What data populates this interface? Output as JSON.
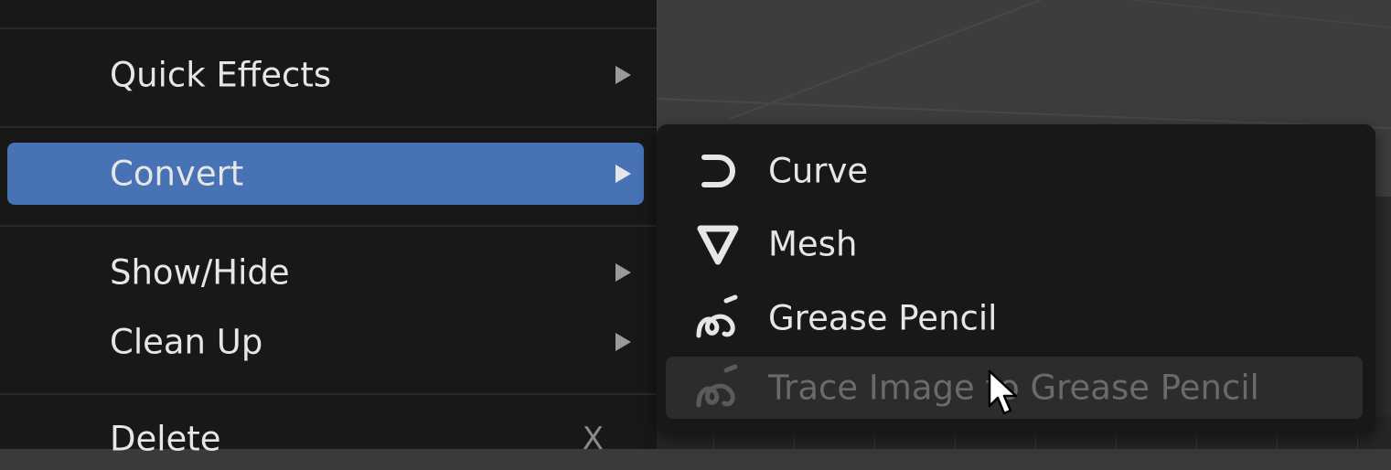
{
  "main_menu": {
    "items": [
      {
        "label": "Quick Effects",
        "has_submenu": true
      },
      {
        "label": "Convert",
        "has_submenu": true,
        "highlighted": true
      },
      {
        "label": "Show/Hide",
        "has_submenu": true
      },
      {
        "label": "Clean Up",
        "has_submenu": true
      },
      {
        "label": "Delete",
        "shortcut": "X"
      }
    ]
  },
  "convert_submenu": {
    "items": [
      {
        "label": "Curve",
        "icon": "curve-icon"
      },
      {
        "label": "Mesh",
        "icon": "mesh-icon"
      },
      {
        "label": "Grease Pencil",
        "icon": "grease-pencil-icon"
      },
      {
        "label": "Trace Image to Grease Pencil",
        "icon": "grease-pencil-icon",
        "disabled": true
      }
    ]
  },
  "colors": {
    "menu_bg": "#181818",
    "highlight": "#4772b3",
    "text": "#e6e6e6",
    "disabled_text": "#6a6a6a"
  }
}
